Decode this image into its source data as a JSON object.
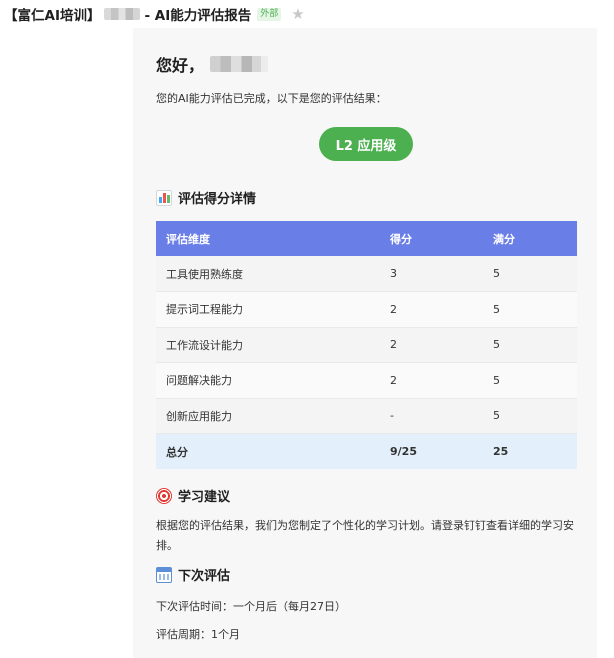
{
  "header": {
    "subject_prefix": "【富仁AI培训】",
    "subject_suffix": "- AI能力评估报告",
    "external_tag": "外部",
    "star_glyph": "★"
  },
  "email": {
    "greeting": "您好，",
    "intro": "您的AI能力评估已完成，以下是您的评估结果：",
    "level": "L2 应用级",
    "level_color": "#4caf50",
    "score_section_title": "评估得分详情",
    "table": {
      "header_color": "#6a7ee8",
      "columns": [
        "评估维度",
        "得分",
        "满分"
      ],
      "rows": [
        [
          "工具使用熟练度",
          "3",
          "5"
        ],
        [
          "提示词工程能力",
          "2",
          "5"
        ],
        [
          "工作流设计能力",
          "2",
          "5"
        ],
        [
          "问题解决能力",
          "2",
          "5"
        ],
        [
          "创新应用能力",
          "-",
          "5"
        ]
      ],
      "total": [
        "总分",
        "9/25",
        "25"
      ]
    },
    "advice_section_title": "学习建议",
    "advice_text": "根据您的评估结果，我们为您制定了个性化的学习计划。请登录钉钉查看详细的学习安排。",
    "next_section_title": "下次评估",
    "next_time": "下次评估时间：一个月后（每月27日）",
    "cycle": "评估周期：1个月"
  }
}
